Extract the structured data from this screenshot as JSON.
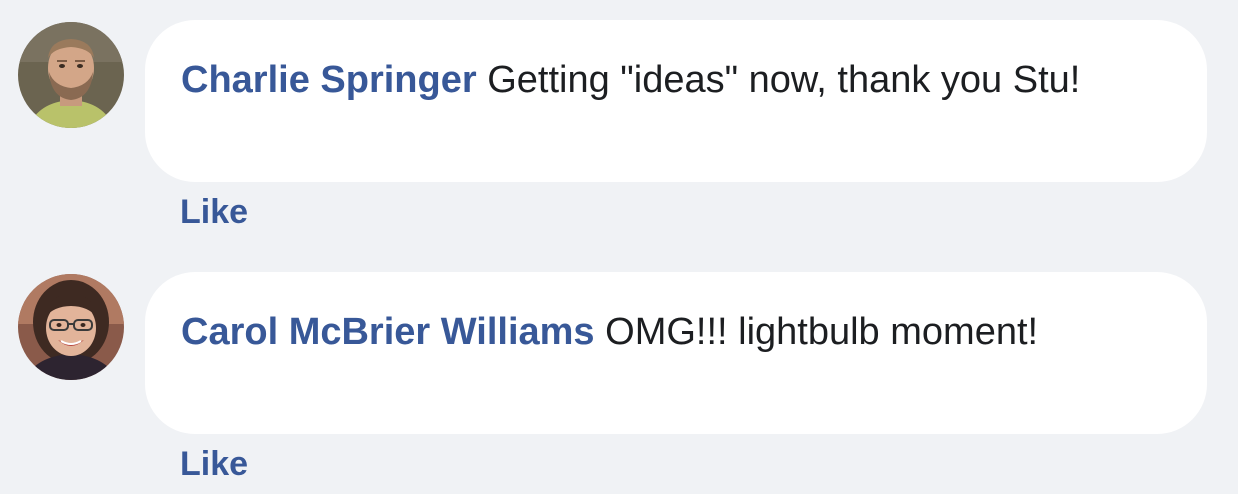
{
  "comments": [
    {
      "author": "Charlie Springer",
      "text": "Getting \"ideas\" now, thank you Stu!",
      "like_label": "Like",
      "avatar_icon": "profile-photo-man-beard"
    },
    {
      "author": "Carol McBrier Williams",
      "text": "OMG!!! lightbulb moment!",
      "like_label": "Like",
      "avatar_icon": "profile-photo-woman-glasses"
    }
  ],
  "colors": {
    "background": "#f0f2f5",
    "bubble": "#ffffff",
    "author_link": "#385898",
    "text": "#1c1e21"
  }
}
